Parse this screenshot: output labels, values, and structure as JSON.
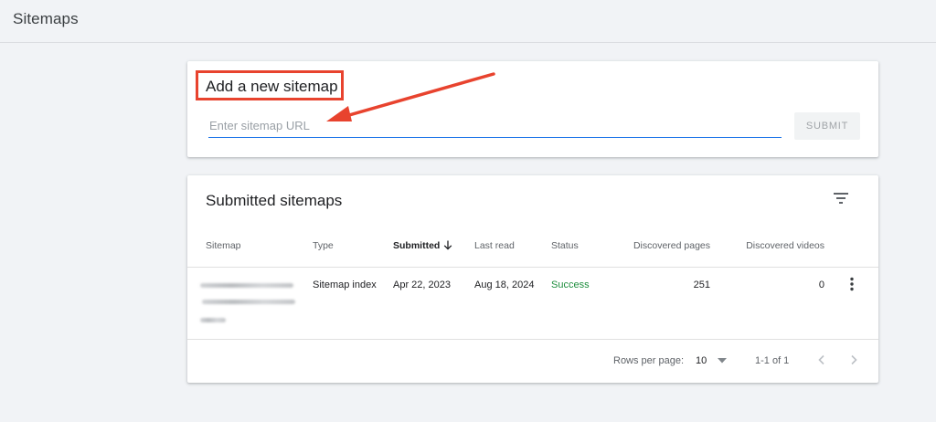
{
  "page": {
    "title": "Sitemaps"
  },
  "add_sitemap": {
    "title": "Add a new sitemap",
    "input_placeholder": "Enter sitemap URL",
    "input_value": "",
    "submit_label": "SUBMIT",
    "annotation_color": "#e8432e"
  },
  "submitted": {
    "title": "Submitted sitemaps",
    "filter_icon": "filter-list-icon",
    "columns": [
      "Sitemap",
      "Type",
      "Submitted",
      "Last read",
      "Status",
      "Discovered pages",
      "Discovered videos"
    ],
    "sort_icon": "arrow-down-icon",
    "rows": [
      {
        "sitemap": "",
        "type": "Sitemap index",
        "submitted": "Apr 22, 2023",
        "last_read": "Aug 18, 2024",
        "status": "Success",
        "discovered_pages": "251",
        "discovered_videos": "0"
      }
    ],
    "pagination": {
      "rows_per_page_label": "Rows per page:",
      "rows_per_page_value": "10",
      "range": "1-1 of 1"
    }
  },
  "colors": {
    "accent": "#1a73e8",
    "success": "#1e8e3e",
    "background": "#f1f3f6"
  }
}
